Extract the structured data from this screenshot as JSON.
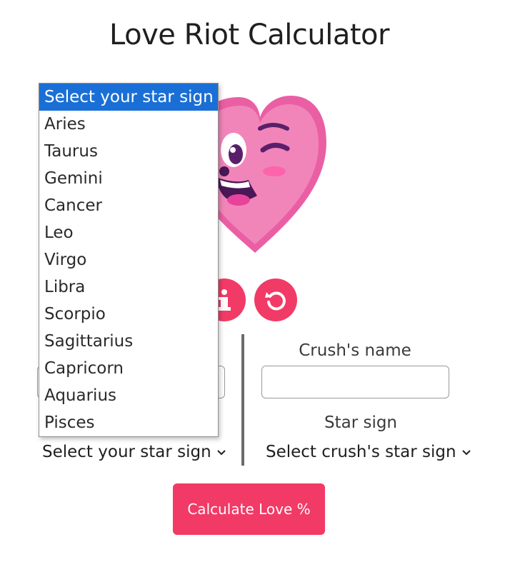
{
  "page": {
    "title": "Love Riot Calculator"
  },
  "colors": {
    "accent": "#f23a66",
    "selection": "#1a6fd6",
    "divider": "#6b6b6b"
  },
  "icons": {
    "hero": "winking-heart-icon",
    "info": "info-icon",
    "reset": "reset-icon",
    "chevron": "chevron-down-icon"
  },
  "form": {
    "crush_name_label": "Crush's name",
    "crush_name_value": "",
    "your_name_value": "",
    "crush_sign_label": "Star sign",
    "your_sign_value": "Select your star sign",
    "crush_sign_value": "Select crush's star sign",
    "calculate_label": "Calculate Love %"
  },
  "dropdown": {
    "open": true,
    "options": [
      "Select your star sign",
      "Aries",
      "Taurus",
      "Gemini",
      "Cancer",
      "Leo",
      "Virgo",
      "Libra",
      "Scorpio",
      "Sagittarius",
      "Capricorn",
      "Aquarius",
      "Pisces"
    ],
    "highlighted": "Select your star sign"
  }
}
